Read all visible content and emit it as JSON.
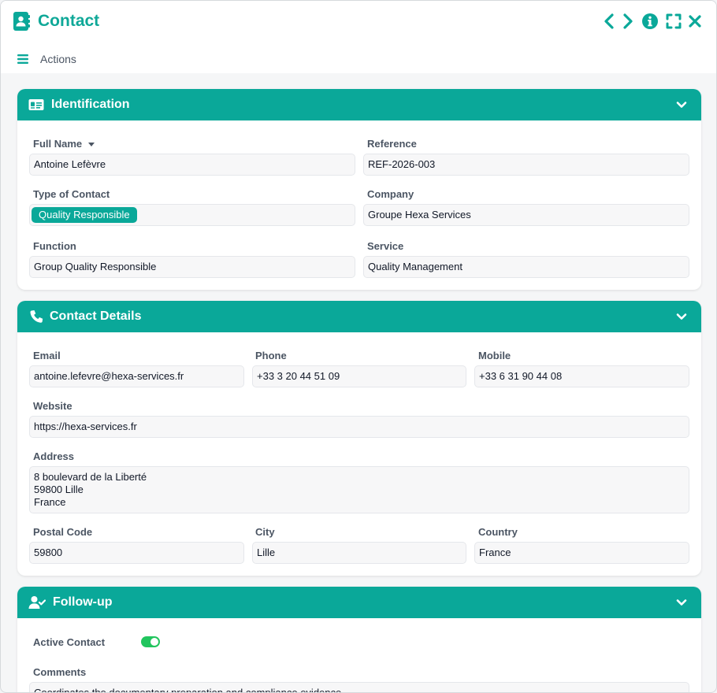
{
  "window": {
    "title": "Contact",
    "actions_label": "Actions",
    "accent_color": "#0aa899"
  },
  "toolbar_icons": [
    "chevron-left-icon",
    "chevron-right-icon",
    "info-icon",
    "expand-icon",
    "close-icon"
  ],
  "identification": {
    "title": "Identification",
    "full_name_label": "Full Name",
    "full_name": "Antoine Lefèvre",
    "reference_label": "Reference",
    "reference": "REF-2026-003",
    "type_label": "Type of Contact",
    "type_value": "Quality Responsible",
    "company_label": "Company",
    "company": "Groupe Hexa Services",
    "function_label": "Function",
    "function": "Group Quality Responsible",
    "service_label": "Service",
    "service": "Quality Management"
  },
  "contact_details": {
    "title": "Contact Details",
    "email_label": "Email",
    "email": "antoine.lefevre@hexa-services.fr",
    "phone_label": "Phone",
    "phone": "+33 3 20 44 51 09",
    "mobile_label": "Mobile",
    "mobile": "+33 6 31 90 44 08",
    "website_label": "Website",
    "website": "https://hexa-services.fr",
    "address_label": "Address",
    "address": "8 boulevard de la Liberté\n59800 Lille\nFrance",
    "postal_label": "Postal Code",
    "postal": "59800",
    "city_label": "City",
    "city": "Lille",
    "country_label": "Country",
    "country": "France"
  },
  "follow_up": {
    "title": "Follow-up",
    "active_label": "Active Contact",
    "active": true,
    "comments_label": "Comments",
    "comments": "Coordinates the documentary preparation and compliance evidence."
  }
}
